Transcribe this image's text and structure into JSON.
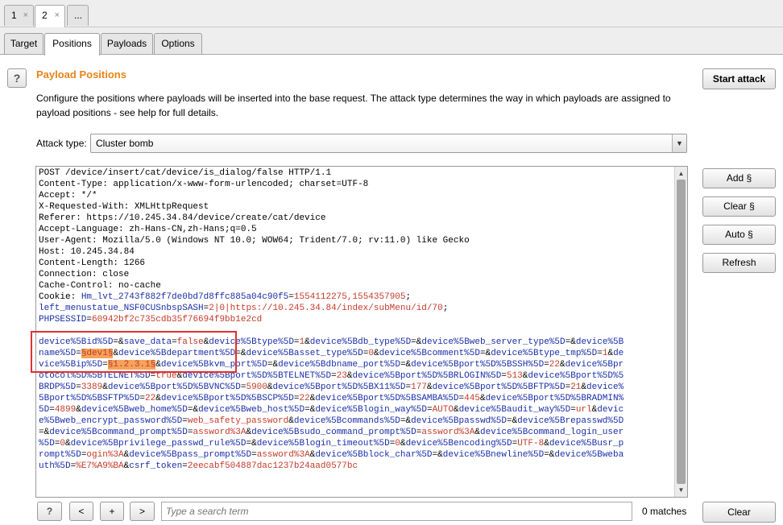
{
  "top_tabs": [
    {
      "label": "1",
      "close": "×"
    },
    {
      "label": "2",
      "close": "×"
    },
    {
      "label": "..."
    }
  ],
  "sub_tabs": [
    "Target",
    "Positions",
    "Payloads",
    "Options"
  ],
  "panel": {
    "help_label": "?",
    "title": "Payload Positions",
    "description": "Configure the positions where payloads will be inserted into the base request. The attack type determines the way in which payloads are assigned to payload positions - see help for full details.",
    "attack_type_label": "Attack type:",
    "attack_type_value": "Cluster bomb"
  },
  "buttons": {
    "start_attack": "Start attack",
    "add": "Add §",
    "clear_marks": "Clear §",
    "auto": "Auto §",
    "refresh": "Refresh",
    "clear": "Clear"
  },
  "search": {
    "help": "?",
    "prev": "<",
    "add": "+",
    "next": ">",
    "placeholder": "Type a search term",
    "matches": "0 matches"
  },
  "request_lines": [
    [
      {
        "t": "POST /device/insert/cat/device/is_dialog/false HTTP/1.1"
      }
    ],
    [
      {
        "t": "Content-Type: application/x-www-form-urlencoded; charset=UTF-8"
      }
    ],
    [
      {
        "t": "Accept: */*"
      }
    ],
    [
      {
        "t": "X-Requested-With: XMLHttpRequest"
      }
    ],
    [
      {
        "t": "Referer: https://10.245.34.84/device/create/cat/device"
      }
    ],
    [
      {
        "t": "Accept-Language: zh-Hans-CN,zh-Hans;q=0.5"
      }
    ],
    [
      {
        "t": "User-Agent: Mozilla/5.0 (Windows NT 10.0; WOW64; Trident/7.0; rv:11.0) like Gecko"
      }
    ],
    [
      {
        "t": "Host: 10.245.34.84"
      }
    ],
    [
      {
        "t": "Content-Length: 1266"
      }
    ],
    [
      {
        "t": "Connection: close"
      }
    ],
    [
      {
        "t": "Cache-Control: no-cache"
      }
    ],
    [
      {
        "t": "Cookie: "
      },
      {
        "t": "Hm_lvt_2743f882f7de0bd7d8ffc885a04c90f5",
        "c": "k"
      },
      {
        "t": "="
      },
      {
        "t": "1554112275,1554357905",
        "c": "v"
      },
      {
        "t": ";"
      }
    ],
    [
      {
        "t": "left_menustatue_NSF0CUSnbspSASH",
        "c": "k"
      },
      {
        "t": "="
      },
      {
        "t": "2|0|https://10.245.34.84/index/subMenu/id/70",
        "c": "v"
      },
      {
        "t": ";"
      }
    ],
    [
      {
        "t": "PHPSESSID",
        "c": "k"
      },
      {
        "t": "="
      },
      {
        "t": "60942bf2c735cdb35f76694f9bb1e2cd",
        "c": "v"
      }
    ],
    [
      {
        "t": ""
      }
    ],
    [
      {
        "t": "device%5Bid%5D",
        "c": "k"
      },
      {
        "t": "="
      },
      {
        "t": "&"
      },
      {
        "t": "save_data",
        "c": "k"
      },
      {
        "t": "="
      },
      {
        "t": "false",
        "c": "v"
      },
      {
        "t": "&"
      },
      {
        "t": "device%5Btype%5D",
        "c": "k"
      },
      {
        "t": "="
      },
      {
        "t": "1",
        "c": "v"
      },
      {
        "t": "&"
      },
      {
        "t": "device%5Bdb_type%5D",
        "c": "k"
      },
      {
        "t": "="
      },
      {
        "t": "&"
      },
      {
        "t": "device%5Bweb_server_type%5D",
        "c": "k"
      },
      {
        "t": "="
      },
      {
        "t": "&"
      },
      {
        "t": "device%5B",
        "c": "k"
      }
    ],
    [
      {
        "t": "name%5D",
        "c": "k"
      },
      {
        "t": "="
      },
      {
        "t": "§dev1§",
        "c": "h"
      },
      {
        "t": "&"
      },
      {
        "t": "device%5Bdepartment%5D",
        "c": "k"
      },
      {
        "t": "="
      },
      {
        "t": "&"
      },
      {
        "t": "device%5Basset_type%5D",
        "c": "k"
      },
      {
        "t": "="
      },
      {
        "t": "0",
        "c": "v"
      },
      {
        "t": "&"
      },
      {
        "t": "device%5Bcomment%5D",
        "c": "k"
      },
      {
        "t": "="
      },
      {
        "t": "&"
      },
      {
        "t": "device%5Btype_tmp%5D",
        "c": "k"
      },
      {
        "t": "="
      },
      {
        "t": "1",
        "c": "v"
      },
      {
        "t": "&"
      },
      {
        "t": "de",
        "c": "k"
      }
    ],
    [
      {
        "t": "vice%5Bip%5D",
        "c": "k"
      },
      {
        "t": "="
      },
      {
        "t": "§1.2.3.1§",
        "c": "h"
      },
      {
        "t": "&"
      },
      {
        "t": "device%5Bkvm_port%5D",
        "c": "k"
      },
      {
        "t": "="
      },
      {
        "t": "&"
      },
      {
        "t": "device%5Bdbname_port%5D",
        "c": "k"
      },
      {
        "t": "="
      },
      {
        "t": "&"
      },
      {
        "t": "device%5Bport%5D%5BSSH%5D",
        "c": "k"
      },
      {
        "t": "="
      },
      {
        "t": "22",
        "c": "v"
      },
      {
        "t": "&"
      },
      {
        "t": "device%5Bpr",
        "c": "k"
      }
    ],
    [
      {
        "t": "otocol%5D%5BTELNET%5D",
        "c": "k"
      },
      {
        "t": "="
      },
      {
        "t": "true",
        "c": "v"
      },
      {
        "t": "&"
      },
      {
        "t": "device%5Bport%5D%5BTELNET%5D",
        "c": "k"
      },
      {
        "t": "="
      },
      {
        "t": "23",
        "c": "v"
      },
      {
        "t": "&"
      },
      {
        "t": "device%5Bport%5D%5BRLOGIN%5D",
        "c": "k"
      },
      {
        "t": "="
      },
      {
        "t": "513",
        "c": "v"
      },
      {
        "t": "&"
      },
      {
        "t": "device%5Bport%5D%5",
        "c": "k"
      }
    ],
    [
      {
        "t": "BRDP%5D",
        "c": "k"
      },
      {
        "t": "="
      },
      {
        "t": "3389",
        "c": "v"
      },
      {
        "t": "&"
      },
      {
        "t": "device%5Bport%5D%5BVNC%5D",
        "c": "k"
      },
      {
        "t": "="
      },
      {
        "t": "5900",
        "c": "v"
      },
      {
        "t": "&"
      },
      {
        "t": "device%5Bport%5D%5BX11%5D",
        "c": "k"
      },
      {
        "t": "="
      },
      {
        "t": "177",
        "c": "v"
      },
      {
        "t": "&"
      },
      {
        "t": "device%5Bport%5D%5BFTP%5D",
        "c": "k"
      },
      {
        "t": "="
      },
      {
        "t": "21",
        "c": "v"
      },
      {
        "t": "&"
      },
      {
        "t": "device%",
        "c": "k"
      }
    ],
    [
      {
        "t": "5Bport%5D%5BSFTP%5D",
        "c": "k"
      },
      {
        "t": "="
      },
      {
        "t": "22",
        "c": "v"
      },
      {
        "t": "&"
      },
      {
        "t": "device%5Bport%5D%5BSCP%5D",
        "c": "k"
      },
      {
        "t": "="
      },
      {
        "t": "22",
        "c": "v"
      },
      {
        "t": "&"
      },
      {
        "t": "device%5Bport%5D%5BSAMBA%5D",
        "c": "k"
      },
      {
        "t": "="
      },
      {
        "t": "445",
        "c": "v"
      },
      {
        "t": "&"
      },
      {
        "t": "device%5Bport%5D%5BRADMIN%",
        "c": "k"
      }
    ],
    [
      {
        "t": "5D",
        "c": "k"
      },
      {
        "t": "="
      },
      {
        "t": "4899",
        "c": "v"
      },
      {
        "t": "&"
      },
      {
        "t": "device%5Bweb_home%5D",
        "c": "k"
      },
      {
        "t": "="
      },
      {
        "t": "&"
      },
      {
        "t": "device%5Bweb_host%5D",
        "c": "k"
      },
      {
        "t": "="
      },
      {
        "t": "&"
      },
      {
        "t": "device%5Blogin_way%5D",
        "c": "k"
      },
      {
        "t": "="
      },
      {
        "t": "AUTO",
        "c": "v"
      },
      {
        "t": "&"
      },
      {
        "t": "device%5Baudit_way%5D",
        "c": "k"
      },
      {
        "t": "="
      },
      {
        "t": "url",
        "c": "v"
      },
      {
        "t": "&"
      },
      {
        "t": "devic",
        "c": "k"
      }
    ],
    [
      {
        "t": "e%5Bweb_encrypt_password%5D",
        "c": "k"
      },
      {
        "t": "="
      },
      {
        "t": "web_safety_password",
        "c": "v"
      },
      {
        "t": "&"
      },
      {
        "t": "device%5Bcommands%5D",
        "c": "k"
      },
      {
        "t": "="
      },
      {
        "t": "&"
      },
      {
        "t": "device%5Bpasswd%5D",
        "c": "k"
      },
      {
        "t": "="
      },
      {
        "t": "&"
      },
      {
        "t": "device%5Brepasswd%5D",
        "c": "k"
      }
    ],
    [
      {
        "t": "="
      },
      {
        "t": "&"
      },
      {
        "t": "device%5Bcommand_prompt%5D",
        "c": "k"
      },
      {
        "t": "="
      },
      {
        "t": "assword%3A",
        "c": "v"
      },
      {
        "t": "&"
      },
      {
        "t": "device%5Bsudo_command_prompt%5D",
        "c": "k"
      },
      {
        "t": "="
      },
      {
        "t": "assword%3A",
        "c": "v"
      },
      {
        "t": "&"
      },
      {
        "t": "device%5Bcommand_login_user",
        "c": "k"
      }
    ],
    [
      {
        "t": "%5D",
        "c": "k"
      },
      {
        "t": "="
      },
      {
        "t": "0",
        "c": "v"
      },
      {
        "t": "&"
      },
      {
        "t": "device%5Bprivilege_passwd_rule%5D",
        "c": "k"
      },
      {
        "t": "="
      },
      {
        "t": "&"
      },
      {
        "t": "device%5Blogin_timeout%5D",
        "c": "k"
      },
      {
        "t": "="
      },
      {
        "t": "0",
        "c": "v"
      },
      {
        "t": "&"
      },
      {
        "t": "device%5Bencoding%5D",
        "c": "k"
      },
      {
        "t": "="
      },
      {
        "t": "UTF-8",
        "c": "v"
      },
      {
        "t": "&"
      },
      {
        "t": "device%5Busr_p",
        "c": "k"
      }
    ],
    [
      {
        "t": "rompt%5D",
        "c": "k"
      },
      {
        "t": "="
      },
      {
        "t": "ogin%3A",
        "c": "v"
      },
      {
        "t": "&"
      },
      {
        "t": "device%5Bpass_prompt%5D",
        "c": "k"
      },
      {
        "t": "="
      },
      {
        "t": "assword%3A",
        "c": "v"
      },
      {
        "t": "&"
      },
      {
        "t": "device%5Bblock_char%5D",
        "c": "k"
      },
      {
        "t": "="
      },
      {
        "t": "&"
      },
      {
        "t": "device%5Bnewline%5D",
        "c": "k"
      },
      {
        "t": "="
      },
      {
        "t": "&"
      },
      {
        "t": "device%5Bweba",
        "c": "k"
      }
    ],
    [
      {
        "t": "uth%5D",
        "c": "k"
      },
      {
        "t": "="
      },
      {
        "t": "%E7%A9%BA",
        "c": "v"
      },
      {
        "t": "&"
      },
      {
        "t": "csrf_token",
        "c": "k"
      },
      {
        "t": "="
      },
      {
        "t": "2eecabf504887dac1237b24aad0577bc",
        "c": "v"
      }
    ]
  ]
}
